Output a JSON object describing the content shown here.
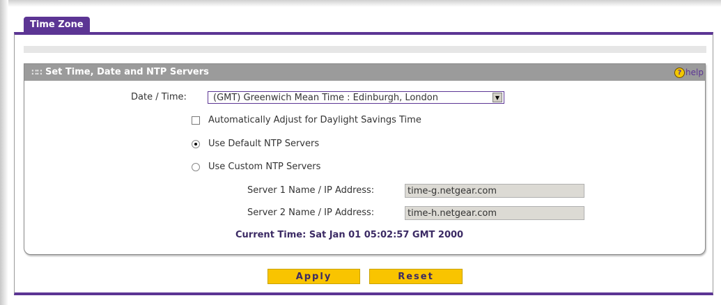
{
  "tab": {
    "label": "Time Zone"
  },
  "section": {
    "title": "Set Time, Date and NTP Servers",
    "help_label": "help"
  },
  "date_time": {
    "label": "Date / Time:",
    "selected": "(GMT) Greenwich Mean Time : Edinburgh, London"
  },
  "dst": {
    "label": "Automatically Adjust for Daylight Savings Time",
    "checked": false
  },
  "ntp": {
    "default_label": "Use Default NTP Servers",
    "custom_label": "Use Custom NTP Servers",
    "selected": "default",
    "server1_label": "Server 1 Name / IP Address:",
    "server1_value": "time-g.netgear.com",
    "server2_label": "Server 2 Name / IP Address:",
    "server2_value": "time-h.netgear.com"
  },
  "current_time": "Current Time: Sat Jan 01 05:02:57 GMT 2000",
  "buttons": {
    "apply": "Apply",
    "reset": "Reset"
  },
  "colors": {
    "accent": "#5c3594",
    "button": "#f9c400",
    "header": "#9b9b9b"
  }
}
